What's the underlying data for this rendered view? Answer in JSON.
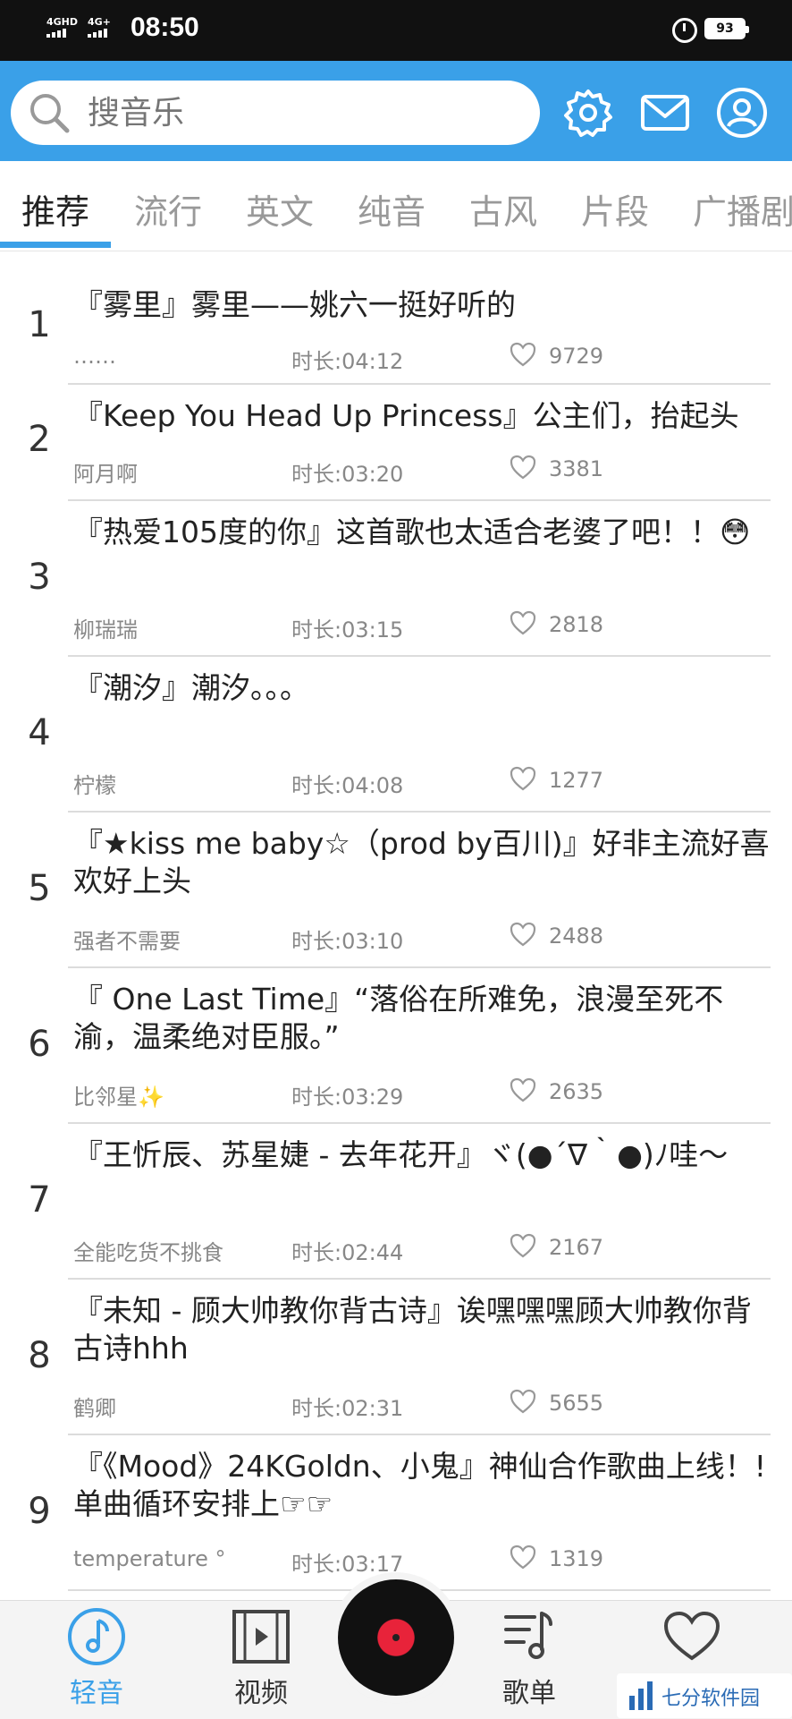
{
  "status_bar": {
    "signal1": "4GHD",
    "signal2": "4G+",
    "time": "08:50",
    "battery": "93"
  },
  "header": {
    "search_placeholder": "搜音乐",
    "icons": [
      "settings-icon",
      "mail-icon",
      "user-icon"
    ]
  },
  "tabs": [
    {
      "label": "推荐",
      "active": true
    },
    {
      "label": "流行",
      "active": false
    },
    {
      "label": "英文",
      "active": false
    },
    {
      "label": "纯音",
      "active": false
    },
    {
      "label": "古风",
      "active": false
    },
    {
      "label": "片段",
      "active": false
    },
    {
      "label": "广播剧",
      "active": false
    }
  ],
  "songs": [
    {
      "rank": "1",
      "title": "『雾里』雾里——姚六一挺好听的",
      "user": "……",
      "duration": "时长:04:12",
      "likes": "9729"
    },
    {
      "rank": "2",
      "title": "『Keep You Head Up Princess』公主们，抬起头",
      "user": "阿月啊",
      "duration": "时长:03:20",
      "likes": "3381"
    },
    {
      "rank": "3",
      "title": "『热爱105度的你』这首歌也太适合老婆了吧！！😳",
      "user": "柳瑞瑞",
      "duration": "时长:03:15",
      "likes": "2818"
    },
    {
      "rank": "4",
      "title": "『潮汐』潮汐。。。",
      "user": "柠檬",
      "duration": "时长:04:08",
      "likes": "1277"
    },
    {
      "rank": "5",
      "title": "『★kiss me baby☆（prod by百川)』好非主流好喜欢好上头",
      "user": "强者不需要",
      "duration": "时长:03:10",
      "likes": "2488"
    },
    {
      "rank": "6",
      "title": "『 One Last Time』“落俗在所难免，浪漫至死不渝，温柔绝对臣服。”",
      "user": "比邻星✨",
      "duration": "时长:03:29",
      "likes": "2635"
    },
    {
      "rank": "7",
      "title": "『王忻辰、苏星婕 - 去年花开』ヾ(●´∇｀●)ﾉ哇～",
      "user": "全能吃货不挑食",
      "duration": "时长:02:44",
      "likes": "2167"
    },
    {
      "rank": "8",
      "title": "『未知 - 顾大帅教你背古诗』诶嘿嘿嘿顾大帅教你背古诗hhh",
      "user": "鹤卿",
      "duration": "时长:02:31",
      "likes": "5655"
    },
    {
      "rank": "9",
      "title": "『《Mood》24KGoldn、小鬼』神仙合作歌曲上线！! 单曲循环安排上☞☞",
      "user": "temperature °",
      "duration": "时长:03:17",
      "likes": "1319"
    }
  ],
  "bottom_nav": [
    {
      "label": "轻音",
      "icon": "music-note-icon",
      "active": true
    },
    {
      "label": "视频",
      "icon": "video-icon",
      "active": false
    },
    {
      "label": "",
      "icon": "record-disc-icon",
      "active": false
    },
    {
      "label": "歌单",
      "icon": "playlist-icon",
      "active": false
    },
    {
      "label": "",
      "icon": "heart-icon",
      "active": false
    }
  ],
  "watermark": "七分软件园",
  "colors": {
    "accent": "#3aa0e8",
    "status_bar": "#111111",
    "disc_red": "#e8233a"
  }
}
